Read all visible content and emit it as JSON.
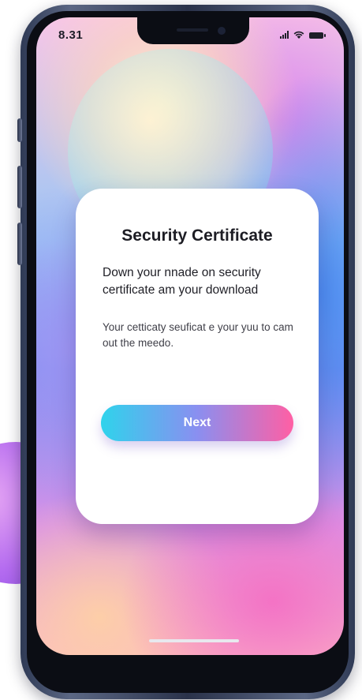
{
  "status_bar": {
    "time": "8.31",
    "icons": [
      "signal-icon",
      "wifi-icon",
      "battery-icon"
    ]
  },
  "card": {
    "title": "Security Certificate",
    "subtitle": "Down your nnade on security certificate am your download",
    "body": "Your cetticaty seuficat e your yuu to cam out the meedo.",
    "button_label": "Next"
  },
  "colors": {
    "button_gradient_start": "#2fd3ec",
    "button_gradient_end": "#ff5fa4",
    "card_background": "#ffffff",
    "text_primary": "#1d1d24"
  }
}
